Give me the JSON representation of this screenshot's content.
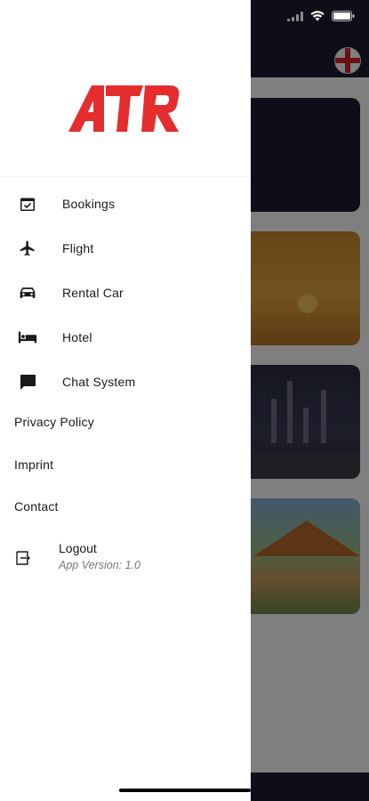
{
  "app": {
    "logo_text": "ATR",
    "brand_color": "#e52d2d"
  },
  "drawer": {
    "menu_items": [
      {
        "label": "Bookings",
        "icon": "calendar-check-icon"
      },
      {
        "label": "Flight",
        "icon": "airplane-icon"
      },
      {
        "label": "Rental Car",
        "icon": "car-icon"
      },
      {
        "label": "Hotel",
        "icon": "bed-icon"
      },
      {
        "label": "Chat System",
        "icon": "chat-bubble-icon"
      }
    ],
    "links": [
      {
        "label": "Privacy Policy"
      },
      {
        "label": "Imprint"
      },
      {
        "label": "Contact"
      }
    ],
    "logout": {
      "label": "Logout",
      "icon": "logout-icon",
      "version": "App Version: 1.0"
    }
  },
  "background": {
    "header_color": "#1c1d33",
    "language_flag": "england-flag-icon"
  }
}
